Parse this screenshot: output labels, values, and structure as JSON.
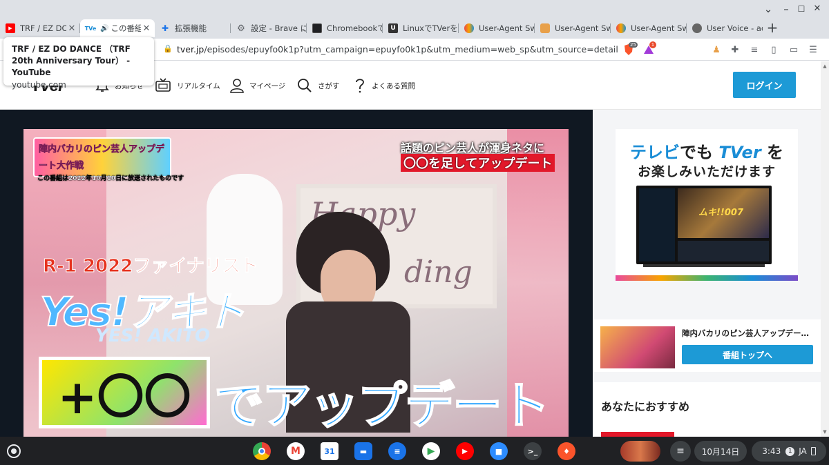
{
  "browser": {
    "tabs": [
      {
        "favicon": "youtube-favicon",
        "title": "TRF / EZ DO DANCE",
        "active": false
      },
      {
        "favicon": "tver-favicon",
        "title": "この番組",
        "audio": true,
        "active": true
      },
      {
        "favicon": "puzzle-favicon",
        "title": "拡張機能",
        "active": false
      },
      {
        "favicon": "gear-favicon",
        "title": "設定 - Brave に",
        "active": false
      },
      {
        "favicon": "terminal-favicon",
        "title": "Chromebookで",
        "active": false
      },
      {
        "favicon": "u-favicon",
        "title": "LinuxでTVerを",
        "active": false
      },
      {
        "favicon": "uas-favicon",
        "title": "User-Agent Sw",
        "active": false
      },
      {
        "favicon": "uas2-favicon",
        "title": "User-Agent Sw",
        "active": false
      },
      {
        "favicon": "uas-favicon",
        "title": "User-Agent Sw",
        "active": false
      },
      {
        "favicon": "uservoice-favicon",
        "title": "User Voice - ad",
        "active": false
      }
    ],
    "new_tab_label": "+",
    "window_controls": [
      "⌄",
      "–",
      "☐",
      "✕"
    ],
    "url_host": "tver.jp",
    "url_rest": "/episodes/epuyfo0k1p?utm_campaign=epuyfo0k1p&utm_medium=web_sp&utm_source=detail",
    "shields_count": "25",
    "rewards_badge": "1"
  },
  "hovercard": {
    "title": "TRF / EZ DO DANCE （TRF 20th Anniversary Tour） - YouTube",
    "site": "youtube.com"
  },
  "site": {
    "logo_t": "T",
    "logo_ver": "Ver",
    "nav": [
      {
        "icon": "bell-icon",
        "label": "お知らせ"
      },
      {
        "icon": "tv-icon",
        "label": "リアルタイム"
      },
      {
        "icon": "person-icon",
        "label": "マイページ"
      },
      {
        "icon": "search-icon",
        "label": "さがす"
      },
      {
        "icon": "question-icon",
        "label": "よくある質問"
      }
    ],
    "login_label": "ログイン"
  },
  "video": {
    "show_logo": "陣内バカリのピン芸人アップデート大作戦",
    "broadcast_note": "この番組は2022年10月10日に放送されたものです",
    "caption_top_1": "話題のピン芸人が渾身ネタに",
    "caption_top_2": "〇〇を足してアップデート",
    "finalist": "R-1 2022ファイナリスト",
    "performer": "Yes!アキト",
    "performer_sub": "YES! AKITO",
    "bottom_box": "+〇〇",
    "bottom_text": "でアップデート",
    "cake_text_1": "Happy",
    "cake_text_2": "ding"
  },
  "sidebar": {
    "ad_line1_pre": "テレビ",
    "ad_line1_mid": "でも ",
    "ad_line1_brand": "TVer",
    "ad_line1_post": " を",
    "ad_line2": "お楽しみいただけます",
    "tv_show_title": "ムキ!!007",
    "series_title": "陣内バカリのピン芸人アップデート大作戦",
    "series_button": "番組トップへ",
    "reco_title": "あなたにおすすめ"
  },
  "shelf": {
    "apps": [
      "chrome-app",
      "gmail-app",
      "calendar-app",
      "files-app",
      "messages-app",
      "meet-app",
      "youtube-app",
      "zoom-app",
      "terminal-app",
      "brave-app"
    ],
    "calendar_day": "31",
    "date": "10月14日",
    "time": "3:43",
    "notification_count": "1",
    "ime": "JA"
  },
  "colors": {
    "accent_blue": "#1d9ad6",
    "tab_strip": "#dee1e6",
    "shelf": "#202124",
    "player_bg": "#101822"
  }
}
